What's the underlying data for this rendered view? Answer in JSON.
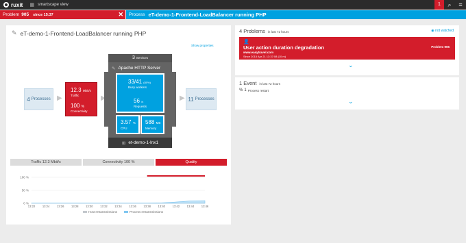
{
  "topbar": {
    "logo": "ruxit",
    "view_title": "smartscape view",
    "notification_count": "1",
    "search_icon": "search-icon",
    "menu_icon": "hamburger-icon"
  },
  "breadcrumb": {
    "problem_label": "Problem",
    "problem_number": "905",
    "problem_since": "since 15:37",
    "process_label": "Process",
    "process_name": "eT-demo-1-Frontend-LoadBalancer running PHP"
  },
  "process_panel": {
    "title": "eT-demo-1-Frontend-LoadBalancer running PHP",
    "show_properties": "Show properties",
    "callers": {
      "count": "4",
      "label": "Processes"
    },
    "callees": {
      "count": "11",
      "label": "Processes"
    },
    "traffic": {
      "value": "12.3",
      "unit": "Mbit/s",
      "label": "Traffic"
    },
    "connectivity": {
      "value": "100",
      "unit": "%",
      "label": "Connectivity"
    },
    "services": {
      "count": "3",
      "label": "Services"
    },
    "service_name": "Apache HTTP Server",
    "busy_workers": {
      "value": "33/41",
      "unit": "(80%)",
      "label": "Busy workers"
    },
    "requests": {
      "value": "56",
      "unit": "/s",
      "label": "Requests"
    },
    "cpu": {
      "value": "3.57",
      "unit": "%",
      "label": "CPU"
    },
    "memory": {
      "value": "588",
      "unit": "MB",
      "label": "Memory"
    },
    "host": "et-demo-1-lnx1",
    "tabs": [
      "Traffic 12.3 Mbit/s",
      "Connectivity 100 %",
      "Quality"
    ],
    "active_tab": 2
  },
  "chart_data": {
    "type": "area",
    "x": [
      "13:22",
      "13:24",
      "13:26",
      "13:28",
      "13:30",
      "13:32",
      "13:34",
      "13:36",
      "13:38",
      "13:40",
      "13:42",
      "13:44",
      "13:46"
    ],
    "series": [
      {
        "name": "Host retransmissions",
        "values": [
          0.5,
          0.5,
          0.5,
          0.5,
          0.5,
          0.5,
          0.5,
          0.5,
          0.5,
          0.5,
          0.5,
          0.5,
          0.5
        ]
      },
      {
        "name": "Process retransmissions",
        "values": [
          1,
          1,
          1,
          1,
          1,
          1,
          1,
          1,
          1,
          2,
          5,
          9,
          10
        ]
      }
    ],
    "yticks": [
      "100 %",
      "50 %",
      "0 %"
    ],
    "ylim": [
      0,
      100
    ],
    "problem_span": [
      "13:38",
      "13:46"
    ],
    "colors": {
      "host": "#c3c7cc",
      "process": "#7fc6f0",
      "problem": "#d31d2b"
    }
  },
  "problems_panel": {
    "title": "4 Problems",
    "subtitle": "in last 72 hours",
    "not_watched": "not watched",
    "card": {
      "title": "User action duration degradation",
      "site": "www.easytravel.com",
      "since": "Since 2015 Apr 21 13:37:08 (10 m)",
      "number": "Problem 905"
    }
  },
  "events_panel": {
    "title": "1 Event",
    "subtitle": "in last 72 hours",
    "item_count": "1",
    "item_label": "Process restart"
  }
}
